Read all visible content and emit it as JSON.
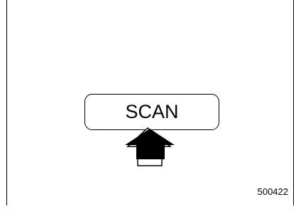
{
  "button": {
    "label": "SCAN"
  },
  "figure": {
    "id": "500422"
  },
  "icons": {
    "arrow": "up-arrow-icon"
  },
  "colors": {
    "line": "#000000",
    "background": "#ffffff"
  }
}
